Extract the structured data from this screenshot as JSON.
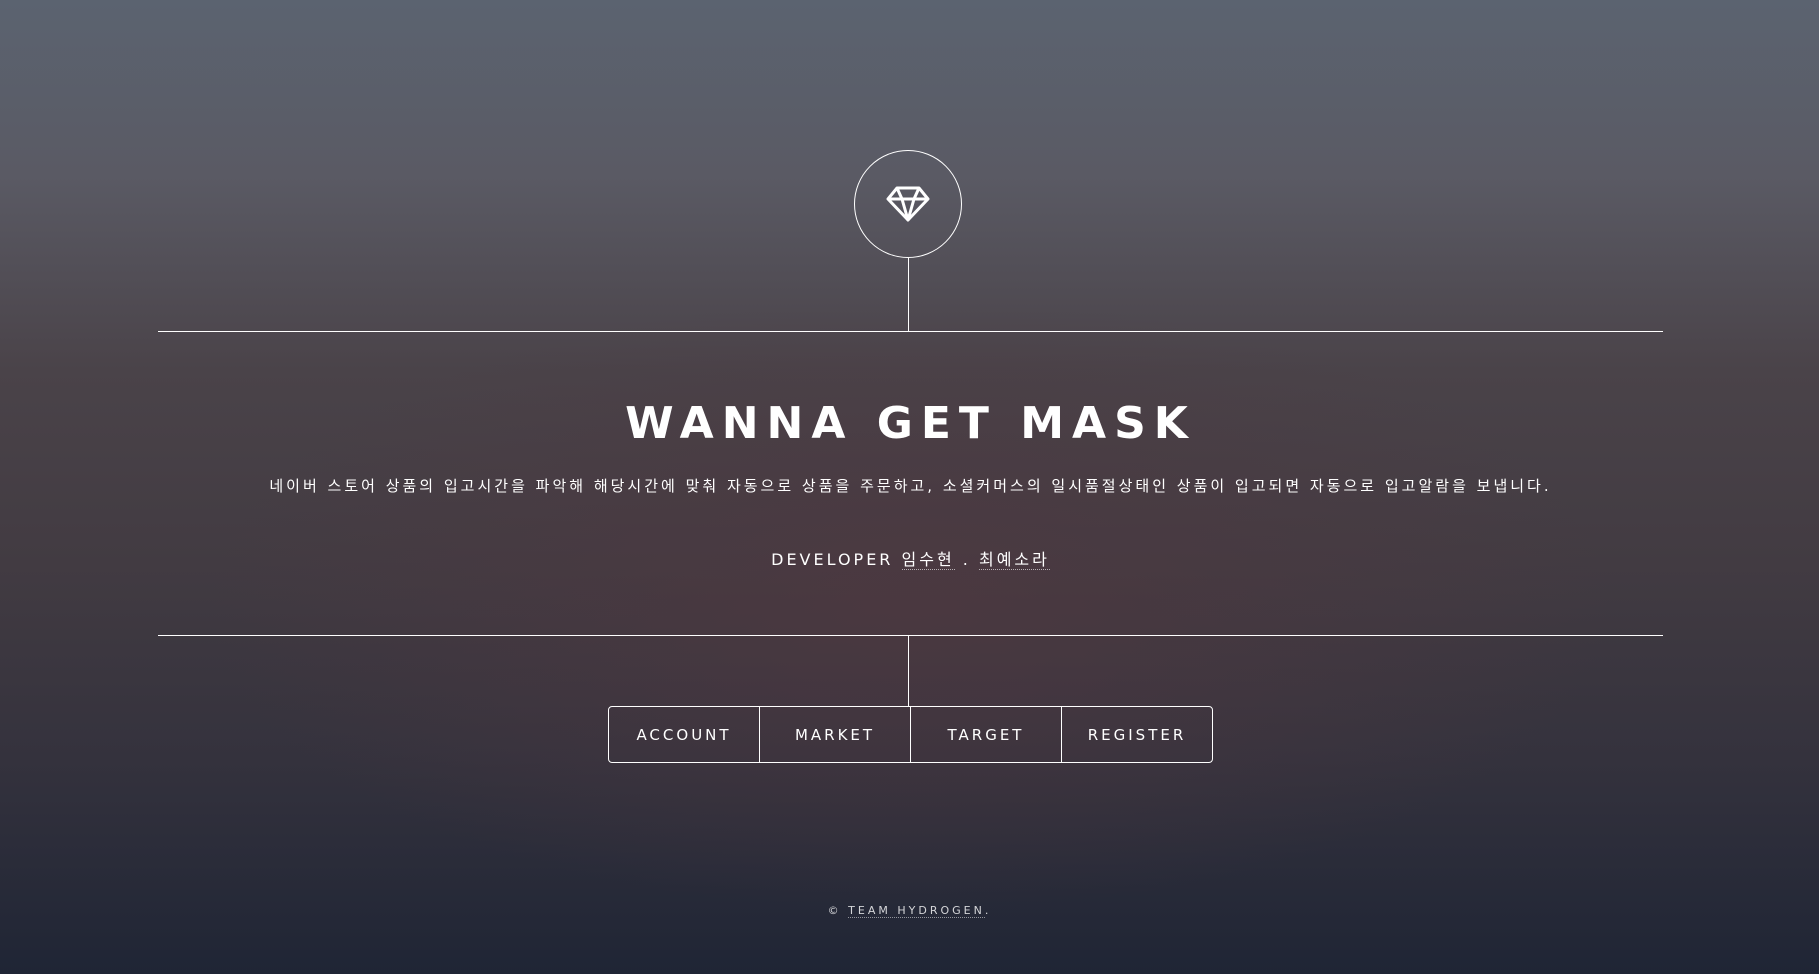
{
  "header": {
    "logo_icon": "diamond-icon",
    "title": "WANNA GET MASK",
    "description": "네이버 스토어 상품의 입고시간을 파악해 해당시간에 맞춰 자동으로 상품을 주문하고, 소셜커머스의 일시품절상태인 상품이 입고되면 자동으로 입고알람을 보냅니다.",
    "developer": {
      "label": "DEVELOPER",
      "names": [
        "임수현",
        "최예소라"
      ],
      "separator": "."
    }
  },
  "nav": {
    "items": [
      {
        "label": "ACCOUNT"
      },
      {
        "label": "MARKET"
      },
      {
        "label": "TARGET"
      },
      {
        "label": "REGISTER"
      }
    ]
  },
  "footer": {
    "copyright_symbol": "©",
    "team": "TEAM HYDROGEN",
    "suffix": "."
  },
  "colors": {
    "text": "#ffffff",
    "background_top": "#5b6370",
    "background_bottom": "#1f2535"
  }
}
